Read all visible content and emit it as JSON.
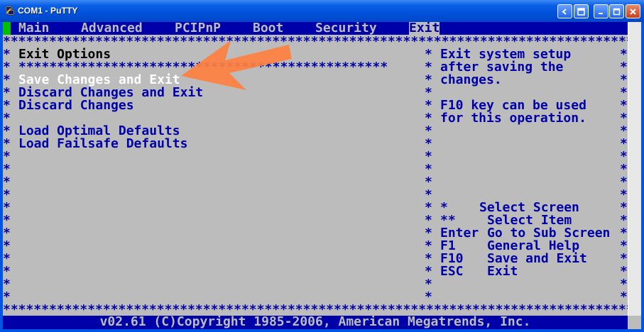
{
  "window": {
    "title": "COM1 - PuTTY"
  },
  "menu": {
    "tabs": [
      "Main",
      "Advanced",
      "PCIPnP",
      "Boot",
      "Security",
      "Exit"
    ],
    "active": "Exit"
  },
  "panel": {
    "title": "Exit Options"
  },
  "options": [
    "Save Changes and Exit",
    "Discard Changes and Exit",
    "Discard Changes",
    "Load Optimal Defaults",
    "Load Failsafe Defaults"
  ],
  "selected_option": "Save Changes and Exit",
  "help": {
    "description": [
      "Exit system setup",
      "after saving the",
      "changes."
    ],
    "note": [
      "F10 key can be used",
      "for this operation."
    ]
  },
  "keys": [
    {
      "key": "*",
      "action": "Select Screen"
    },
    {
      "key": "**",
      "action": "Select Item"
    },
    {
      "key": "Enter",
      "action": "Go to Sub Screen"
    },
    {
      "key": "F1",
      "action": "General Help"
    },
    {
      "key": "F10",
      "action": "Save and Exit"
    },
    {
      "key": "ESC",
      "action": "Exit"
    }
  ],
  "footer": "v02.61 (C)Copyright 1985-2006, American Megatrends, Inc.",
  "colors": {
    "bios_blue": "#0000a8",
    "bios_gray": "#bcbcbc",
    "selected_text": "#ffffff",
    "arrow": "#ff8040",
    "cursor_green": "#00c000"
  }
}
